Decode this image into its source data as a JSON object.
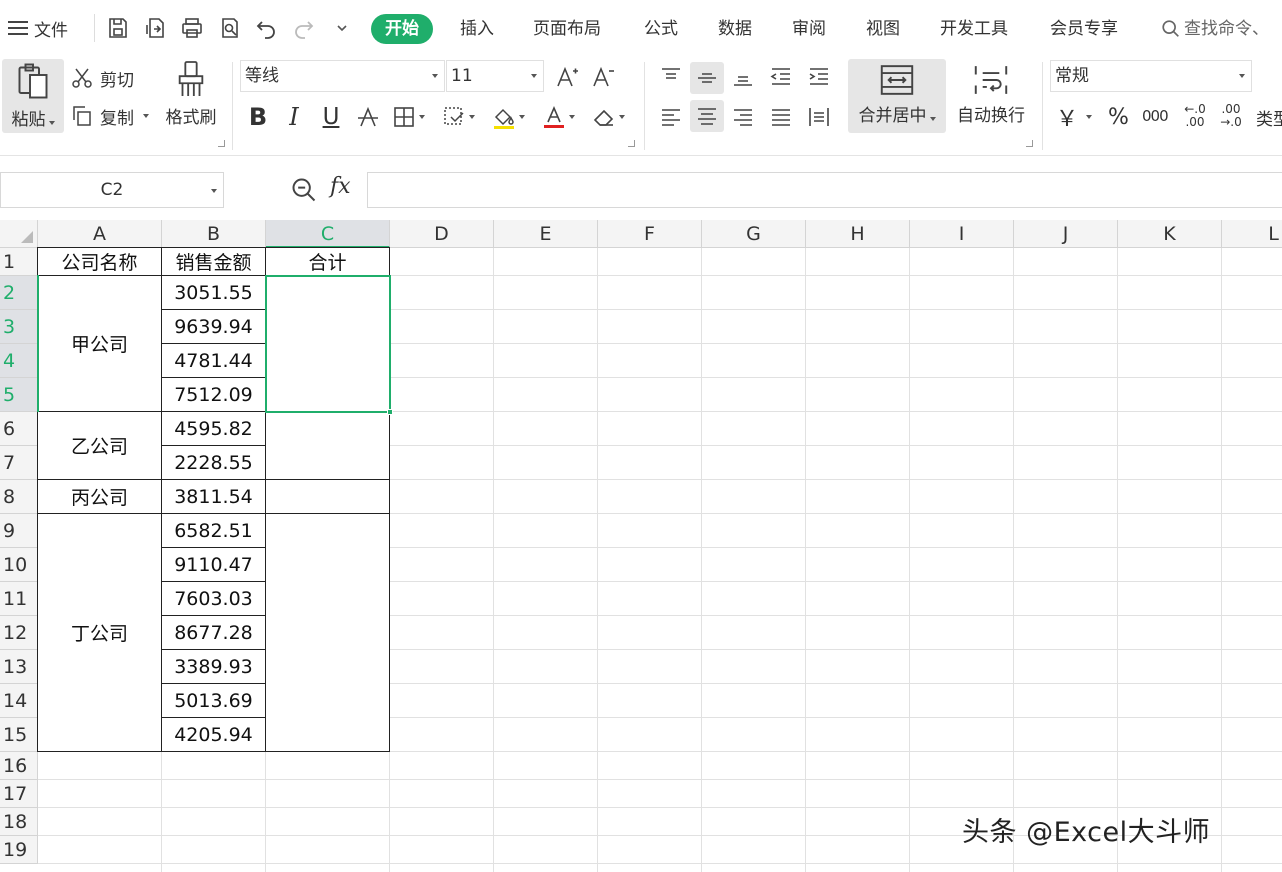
{
  "menu": {
    "file": "文件",
    "tabs": [
      "开始",
      "插入",
      "页面布局",
      "公式",
      "数据",
      "审阅",
      "视图",
      "开发工具",
      "会员专享"
    ],
    "search_placeholder": "查找命令、"
  },
  "ribbon": {
    "paste": "粘贴",
    "cut": "剪切",
    "copy": "复制",
    "format_painter": "格式刷",
    "font_name": "等线",
    "font_size": "11",
    "bold": "B",
    "italic": "I",
    "underline": "U",
    "merge_center": "合并居中",
    "wrap_text": "自动换行",
    "number_format": "常规",
    "currency_symbol": "￥",
    "percent_symbol": "%",
    "thousands_symbol": "000",
    "increase_decimal": "←.0 .00",
    "decrease_decimal": ".00 →.0",
    "type_convert": "类型"
  },
  "formula_bar": {
    "name_box": "C2",
    "fx_label": "fx",
    "formula": ""
  },
  "sheet": {
    "selected_cell": "C2",
    "columns": [
      "A",
      "B",
      "C",
      "D",
      "E",
      "F",
      "G",
      "H",
      "I",
      "J",
      "K",
      "L"
    ],
    "rows": [
      "1",
      "2",
      "3",
      "4",
      "5",
      "6",
      "7",
      "8",
      "9",
      "10",
      "11",
      "12",
      "13",
      "14",
      "15",
      "16",
      "17",
      "18",
      "19"
    ],
    "header": {
      "a1": "公司名称",
      "b1": "销售金额",
      "c1": "合计"
    },
    "groups": [
      {
        "company": "甲公司",
        "values": [
          "3051.55",
          "9639.94",
          "4781.44",
          "7512.09"
        ]
      },
      {
        "company": "乙公司",
        "values": [
          "4595.82",
          "2228.55"
        ]
      },
      {
        "company": "丙公司",
        "values": [
          "3811.54"
        ]
      },
      {
        "company": "丁公司",
        "values": [
          "6582.51",
          "9110.47",
          "7603.03",
          "8677.28",
          "3389.93",
          "5013.69",
          "4205.94"
        ]
      }
    ]
  },
  "watermark": "头条 @Excel大斗师",
  "colors": {
    "accent": "#1fae6b",
    "font_color_bar": "#e02020",
    "fill_color_bar": "#f5e000"
  }
}
